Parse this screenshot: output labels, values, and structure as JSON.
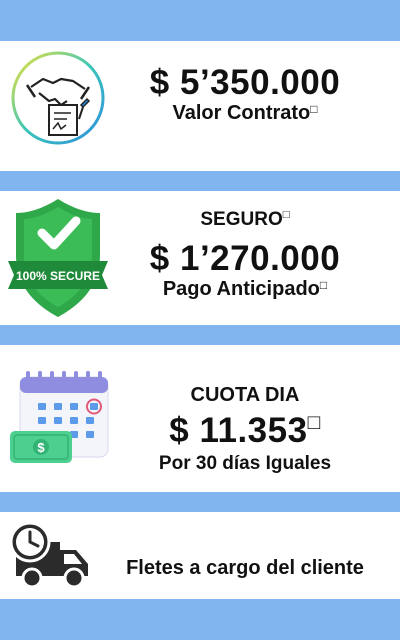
{
  "contract": {
    "amount": "$ 5’350.000",
    "label": "Valor Contrato",
    "icon": "handshake-contract-icon"
  },
  "insurance": {
    "title": "SEGURO",
    "amount": "$ 1’270.000",
    "label": "Pago Anticipado",
    "badge_text": "100% SECURE",
    "icon": "shield-secure-icon"
  },
  "daily_fee": {
    "title": "CUOTA DIA",
    "amount": "$ 11.353",
    "label": "Por 30 días Iguales",
    "icon": "calendar-money-icon"
  },
  "freight": {
    "label": "Fletes a cargo del cliente",
    "icon": "truck-clock-icon"
  },
  "colors": {
    "background": "#81b5ef",
    "card": "#ffffff",
    "shield_green": "#2fa84a",
    "calendar_purple": "#8f8de0",
    "money_green": "#4ccf8f"
  }
}
